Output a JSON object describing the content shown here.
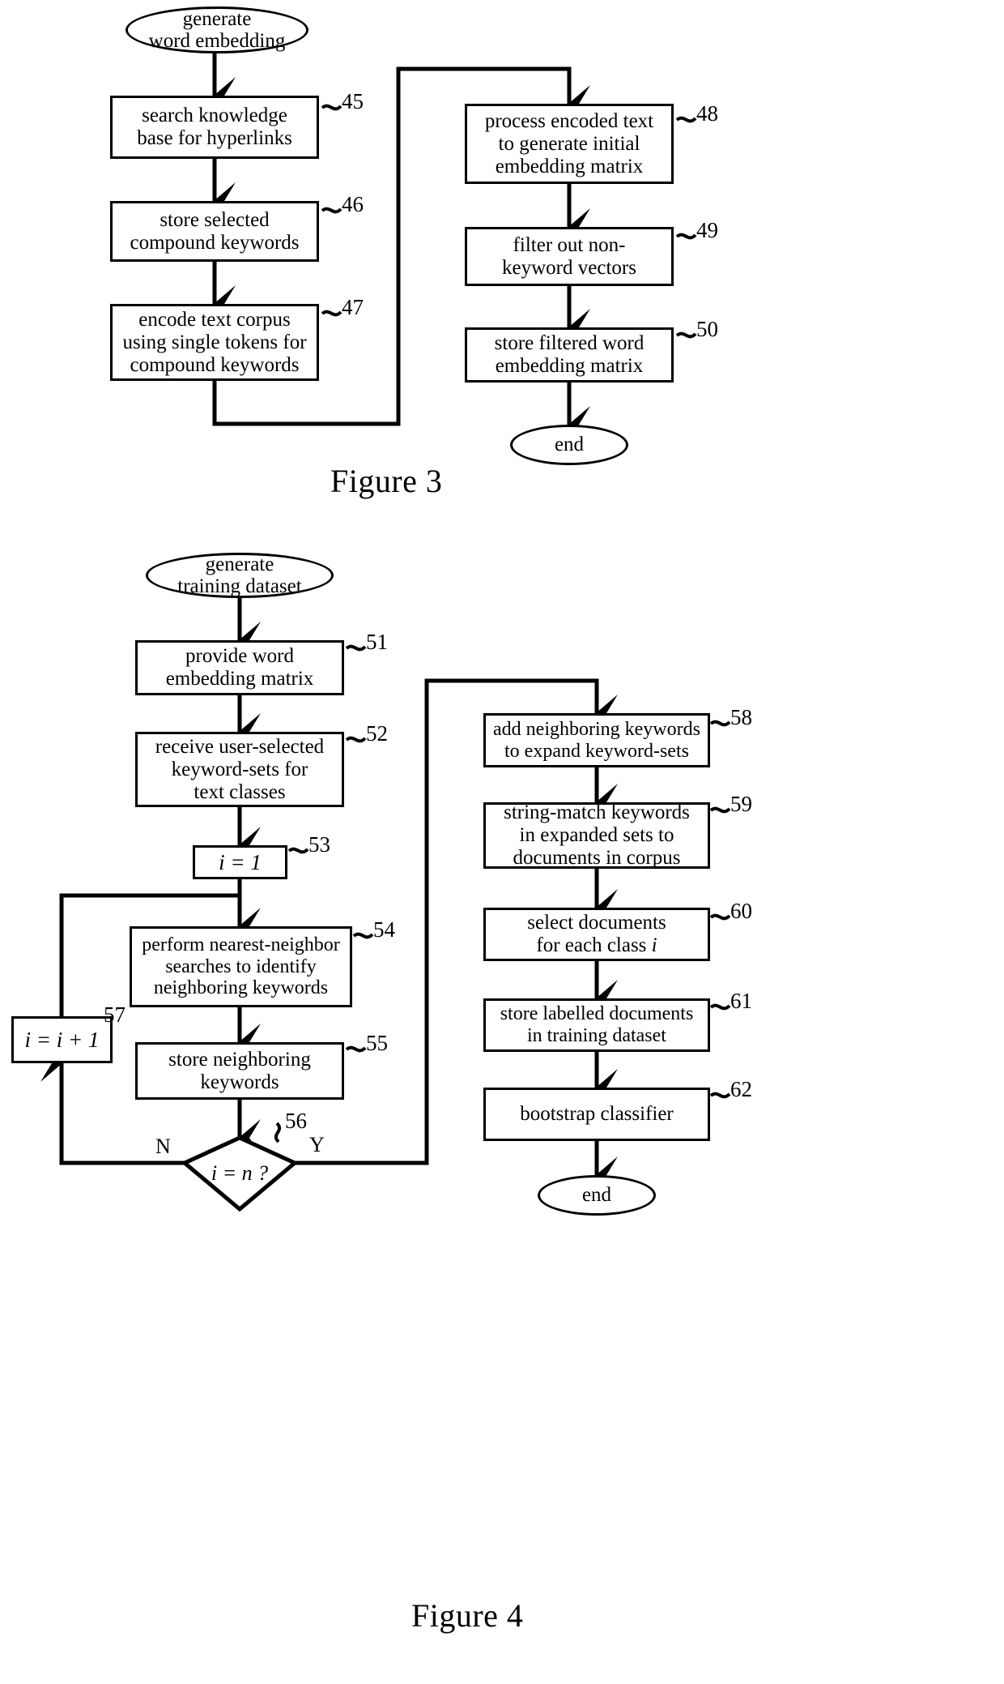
{
  "figures": [
    {
      "id": "figure-3",
      "caption": "Figure 3",
      "start": {
        "label": "generate\nword embedding"
      },
      "end": {
        "label": "end"
      },
      "left_column": [
        {
          "ref": "45",
          "label": "search knowledge\nbase for hyperlinks"
        },
        {
          "ref": "46",
          "label": "store selected\ncompound keywords"
        },
        {
          "ref": "47",
          "label": "encode text corpus\nusing single tokens for\ncompound keywords"
        }
      ],
      "right_column": [
        {
          "ref": "48",
          "label": "process encoded text\nto generate initial\nembedding matrix"
        },
        {
          "ref": "49",
          "label": "filter out non-\nkeyword vectors"
        },
        {
          "ref": "50",
          "label": "store filtered word\nembedding matrix"
        }
      ]
    },
    {
      "id": "figure-4",
      "caption": "Figure 4",
      "start": {
        "label": "generate\ntraining dataset"
      },
      "end": {
        "label": "end"
      },
      "left_column": [
        {
          "ref": "51",
          "label": "provide word\nembedding matrix"
        },
        {
          "ref": "52",
          "label": "receive user-selected\nkeyword-sets for\ntext classes"
        },
        {
          "ref": "53",
          "label": "i = 1",
          "math": true
        },
        {
          "ref": "54",
          "label": "perform nearest-neighbor\nsearches to identify\nneighboring keywords"
        },
        {
          "ref": "55",
          "label": "store neighboring\nkeywords"
        }
      ],
      "decision": {
        "ref": "56",
        "label": "i = n ?",
        "no_label": "N",
        "yes_label": "Y"
      },
      "increment": {
        "ref": "57",
        "label": "i = i + 1",
        "math": true
      },
      "right_column": [
        {
          "ref": "58",
          "label": "add neighboring keywords\nto expand keyword-sets"
        },
        {
          "ref": "59",
          "label": "string-match keywords\nin expanded sets to\ndocuments in corpus"
        },
        {
          "ref": "60",
          "label": "select documents\nfor each class i",
          "italic_tail": true
        },
        {
          "ref": "61",
          "label": "store labelled documents\nin training dataset"
        },
        {
          "ref": "62",
          "label": "bootstrap classifier"
        }
      ]
    }
  ],
  "colors": {
    "ink": "#000000",
    "paper": "#ffffff"
  }
}
